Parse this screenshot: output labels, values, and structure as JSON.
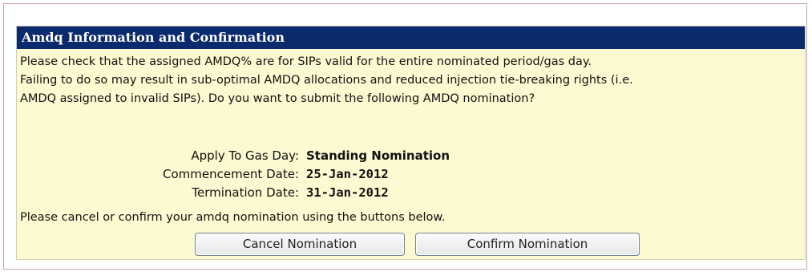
{
  "dialog": {
    "title": "Amdq Information and Confirmation",
    "message_lines": [
      "Please check that the assigned AMDQ% are for SIPs valid for the entire nominated period/gas day.",
      "Failing to do so may result in sub-optimal AMDQ allocations and reduced injection tie-breaking rights (i.e.",
      "AMDQ assigned to invalid SIPs). Do you want to submit the following AMDQ nomination?"
    ],
    "details": {
      "gas_day_label": "Apply To Gas Day:",
      "gas_day_value": "Standing Nomination",
      "commencement_label": "Commencement Date:",
      "commencement_value": "25-Jan-2012",
      "termination_label": "Termination Date:",
      "termination_value": "31-Jan-2012"
    },
    "instruction": "Please cancel or confirm your amdq nomination using the buttons below.",
    "buttons": {
      "cancel_label": "Cancel Nomination",
      "confirm_label": "Confirm Nomination"
    }
  },
  "colors": {
    "title_bar": "#0b2a6e",
    "dialog_background": "#fdfad2"
  }
}
